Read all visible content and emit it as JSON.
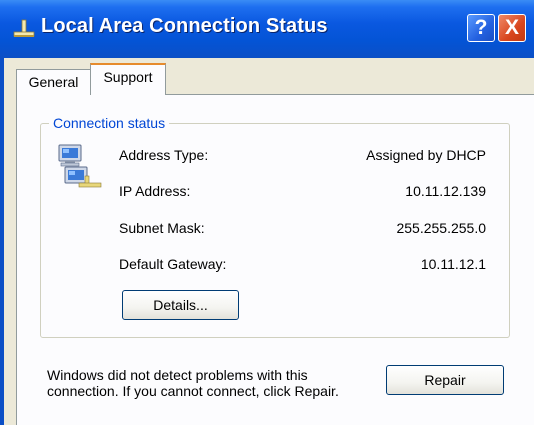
{
  "window": {
    "title": "Local Area Connection Status"
  },
  "title_buttons": {
    "help_label": "?",
    "close_label": "X"
  },
  "tabs": [
    {
      "label": "General",
      "selected": false
    },
    {
      "label": "Support",
      "selected": true
    }
  ],
  "group": {
    "legend": "Connection status",
    "icon": "network-connection-icon",
    "rows": [
      {
        "label": "Address Type:",
        "value": "Assigned by DHCP"
      },
      {
        "label": "IP Address:",
        "value": "10.11.12.139"
      },
      {
        "label": "Subnet Mask:",
        "value": "255.255.255.0"
      },
      {
        "label": "Default Gateway:",
        "value": "10.11.12.1"
      }
    ],
    "details_label": "Details..."
  },
  "message": "Windows did not detect problems with this connection. If you cannot connect, click Repair.",
  "repair_label": "Repair",
  "colors": {
    "title_bar": "#0454d6",
    "tab_highlight": "#e68b2c",
    "legend_text": "#0046d5",
    "close_button": "#d8461e"
  }
}
